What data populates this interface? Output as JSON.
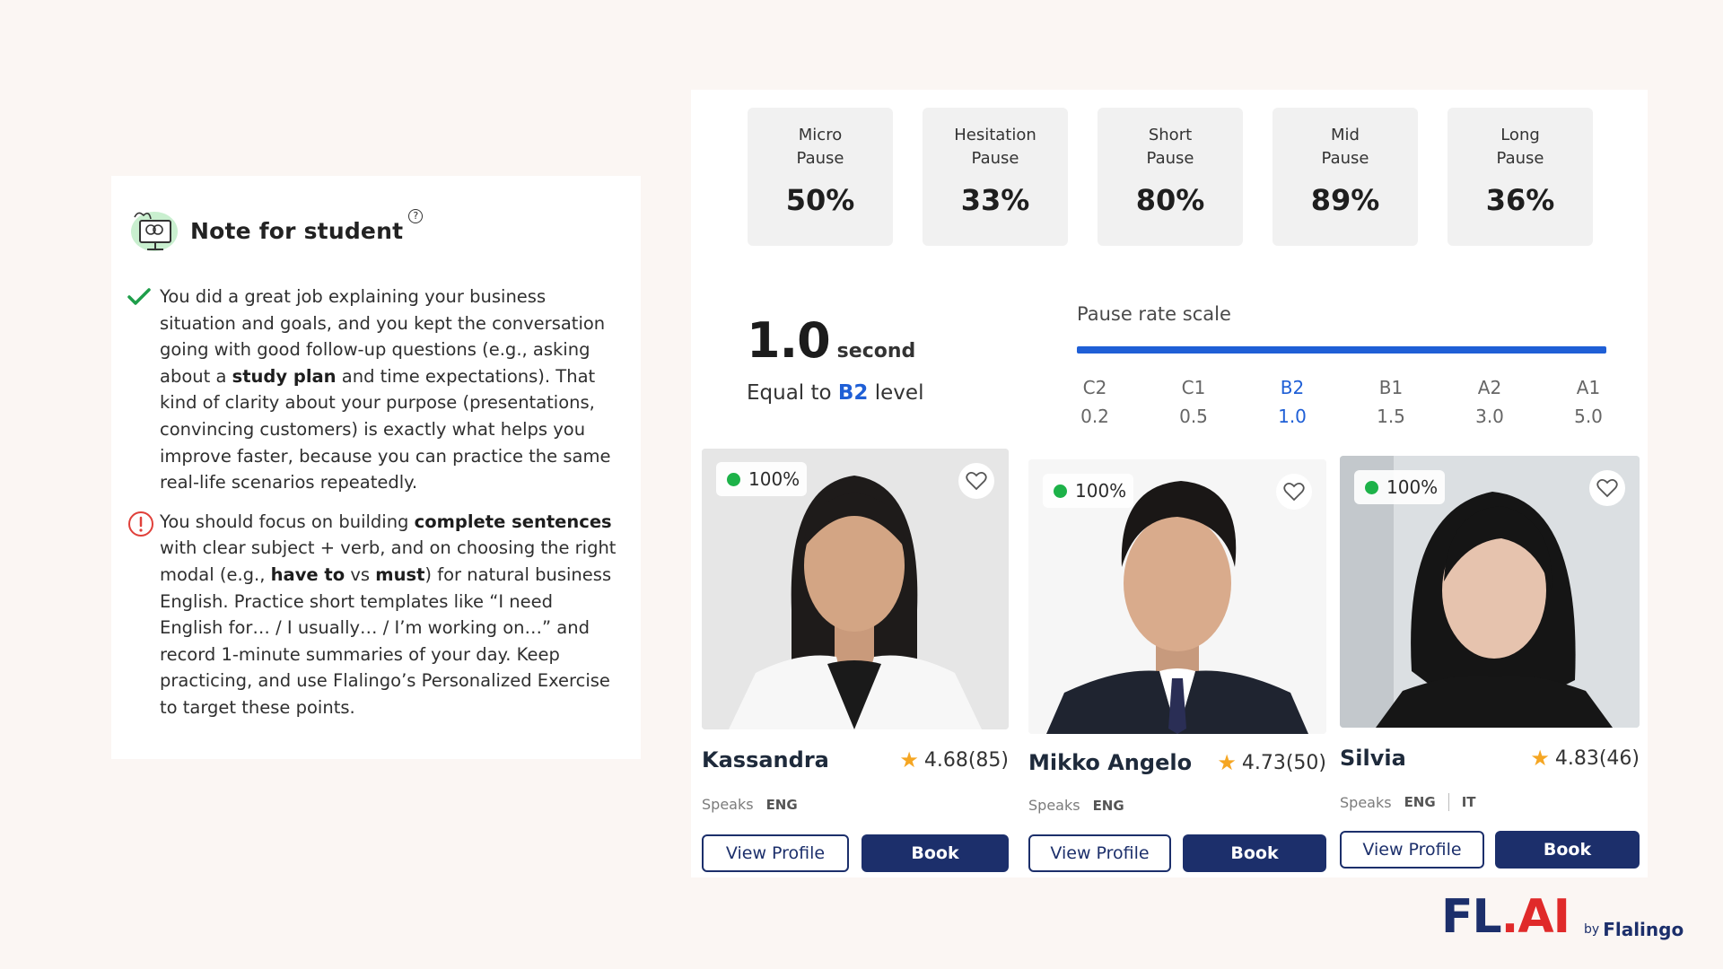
{
  "note": {
    "title": "Note for student",
    "positive": {
      "p1": "You did a great job explaining your business situation and goals, and you kept the conversation going with good follow-up questions (e.g., asking about a ",
      "b1": "study plan",
      "p2": " and time expectations). That kind of clarity about your purpose (presentations, convincing customers) is exactly what helps you improve faster, because you can practice the same real-life scenarios repeatedly."
    },
    "improve": {
      "p1": "You should focus on building ",
      "b1": "complete sentences",
      "p2": " with clear subject + verb, and on choosing the right modal (e.g., ",
      "b2": "have to",
      "p3": " vs ",
      "b3": "must",
      "p4": ") for natural business English. Practice short templates like “I need English for… / I usually… / I’m working on…” and record 1-minute summaries of your day. Keep practicing, and use Flalingo’s Personalized Exercise to target these points."
    }
  },
  "pauses": [
    {
      "line1": "Micro",
      "line2": "Pause",
      "value": "50%"
    },
    {
      "line1": "Hesitation",
      "line2": "Pause",
      "value": "33%"
    },
    {
      "line1": "Short",
      "line2": "Pause",
      "value": "80%"
    },
    {
      "line1": "Mid",
      "line2": "Pause",
      "value": "89%"
    },
    {
      "line1": "Long",
      "line2": "Pause",
      "value": "36%"
    }
  ],
  "rate": {
    "value": "1.0",
    "unit": "second",
    "equal_prefix": "Equal to ",
    "level": "B2",
    "equal_suffix": " level"
  },
  "scale": {
    "title": "Pause rate scale",
    "items": [
      {
        "level": "C2",
        "value": "0.2"
      },
      {
        "level": "C1",
        "value": "0.5"
      },
      {
        "level": "B2",
        "value": "1.0"
      },
      {
        "level": "B1",
        "value": "1.5"
      },
      {
        "level": "A2",
        "value": "3.0"
      },
      {
        "level": "A1",
        "value": "5.0"
      }
    ],
    "active_index": 2
  },
  "teachers": [
    {
      "name": "Kassandra",
      "rating": "4.68(85)",
      "status": "100%",
      "speaks_label": "Speaks",
      "languages": [
        "ENG"
      ],
      "profile_label": "View Profile",
      "book_label": "Book"
    },
    {
      "name": "Mikko Angelo",
      "rating": "4.73(50)",
      "status": "100%",
      "speaks_label": "Speaks",
      "languages": [
        "ENG"
      ],
      "profile_label": "View Profile",
      "book_label": "Book"
    },
    {
      "name": "Silvia",
      "rating": "4.83(46)",
      "status": "100%",
      "speaks_label": "Speaks",
      "languages": [
        "ENG",
        "IT"
      ],
      "profile_label": "View Profile",
      "book_label": "Book"
    }
  ],
  "logo": {
    "fl": "FL",
    "dot": ".",
    "ai": "AI",
    "by": "by",
    "brand": "Flalingo"
  },
  "colors": {
    "accent": "#1f5fd6",
    "navy": "#1c2f6b",
    "online": "#1db249",
    "star": "#f5a623"
  }
}
